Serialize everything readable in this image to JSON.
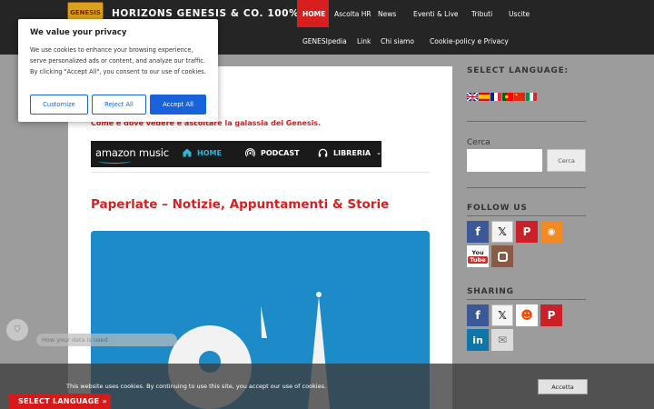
{
  "header": {
    "logo_text": "GENESIS",
    "site_title": "HORIZONS GENESIS & CO. 100%",
    "nav_row1": [
      {
        "label": "HOME",
        "active": true
      },
      {
        "label": "Ascolta HR"
      },
      {
        "label": "News"
      },
      {
        "label": "Eventi & Live"
      },
      {
        "label": "Tributi"
      },
      {
        "label": "Uscite"
      }
    ],
    "nav_row2": [
      {
        "label": "GENESIpedia"
      },
      {
        "label": "Link"
      },
      {
        "label": "Chi siamo"
      },
      {
        "label": "Cookie-policy e Privacy"
      }
    ]
  },
  "cookie_popup": {
    "title": "We value your privacy",
    "text": "We use cookies to enhance your browsing experience, serve personalized ads or content, and analyze our traffic. By clicking \"Accept All\", you consent to our use of cookies.",
    "buttons": {
      "customize": "Customize",
      "reject": "Reject All",
      "accept": "Accept All"
    }
  },
  "main": {
    "subtitle": "Come e dove vedere e ascoltare la galassia dei Genesis.",
    "amazon_bar": {
      "logo": "amazon music",
      "home": "HOME",
      "podcast": "PODCAST",
      "libreria": "LIBRERIA"
    },
    "post_title": "Paperlate – Notizie, Appuntamenti & Storie"
  },
  "sidebar": {
    "select_language_heading": "SELECT LANGUAGE:",
    "flags": [
      "english-flag",
      "spanish-flag",
      "french-flag",
      "portuguese-flag",
      "chinese-flag",
      "italian-flag"
    ],
    "search_label": "Cerca",
    "search_button": "Cerca",
    "follow_heading": "FOLLOW US",
    "follow_icons": [
      "facebook-icon",
      "x-icon",
      "pinterest-icon",
      "rss-icon",
      "youtube-icon",
      "instagram-icon"
    ],
    "sharing_heading": "SHARING",
    "sharing_icons": [
      "facebook-icon",
      "x-icon",
      "reddit-icon",
      "pinterest-icon",
      "linkedin-icon",
      "email-icon"
    ]
  },
  "privacy_widget": {
    "label": "How your data is used"
  },
  "cookie_notice": {
    "text": "This website uses cookies. By continuing to use this site, you accept our use of cookies.",
    "button": "Accetta"
  },
  "select_language_button": "SELECT LANGUAGE »",
  "colors": {
    "accent_red": "#d81f1f",
    "header_bg": "#252525",
    "cookie_blue": "#1863dc",
    "amazon_cyan": "#2bb5d8"
  }
}
